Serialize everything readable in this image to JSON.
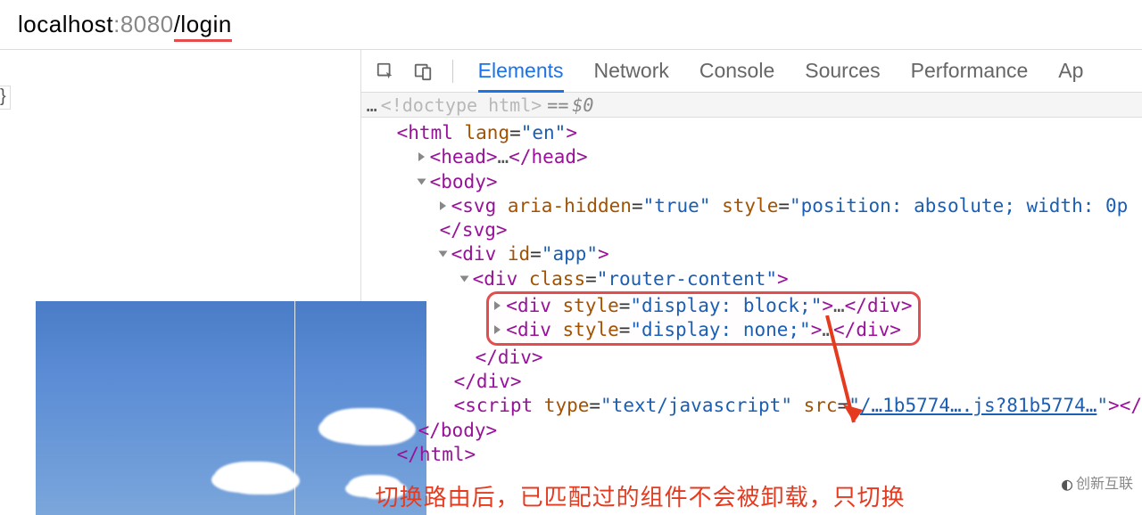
{
  "address": {
    "host": "localhost",
    "port": ":8080",
    "path": "/login"
  },
  "left": {
    "stray_char": "}"
  },
  "devtools": {
    "tabs": {
      "elements": "Elements",
      "network": "Network",
      "console": "Console",
      "sources": "Sources",
      "performance": "Performance",
      "app_partial": "Ap"
    },
    "crumb": {
      "doctype": "<!doctype html>",
      "eq": "==",
      "dollar": "$0"
    }
  },
  "dom": {
    "html_open": {
      "tag": "html",
      "attr": "lang",
      "val": "\"en\""
    },
    "head": {
      "tag": "head"
    },
    "body_open": {
      "tag": "body"
    },
    "svg": {
      "tag": "svg",
      "attr1_name": "aria-hidden",
      "attr1_val": "\"true\"",
      "attr2_name": "style",
      "attr2_val": "\"position: absolute; width: 0p"
    },
    "svg_close": {
      "tag": "svg"
    },
    "app": {
      "tag": "div",
      "attr": "id",
      "val": "\"app\""
    },
    "rc": {
      "tag": "div",
      "attr": "class",
      "val": "\"router-content\""
    },
    "div_block": {
      "tag": "div",
      "attr": "style",
      "val": "\"display: block;\""
    },
    "div_none": {
      "tag": "div",
      "attr": "style",
      "val": "\"display: none;\""
    },
    "div_close": {
      "text": "</div>"
    },
    "div_close2": {
      "text": "</div>"
    },
    "script": {
      "tag": "script",
      "attr1_name": "type",
      "attr1_val": "\"text/javascript\"",
      "attr2_name": "src",
      "link": "/…1b5774….js?81b5774…",
      "close": "</"
    },
    "body_close": {
      "text": "</body>"
    },
    "html_close": {
      "text": "</html>"
    }
  },
  "annotation": "切换路由后，已匹配过的组件不会被卸载，只切换",
  "watermark": "创新互联"
}
